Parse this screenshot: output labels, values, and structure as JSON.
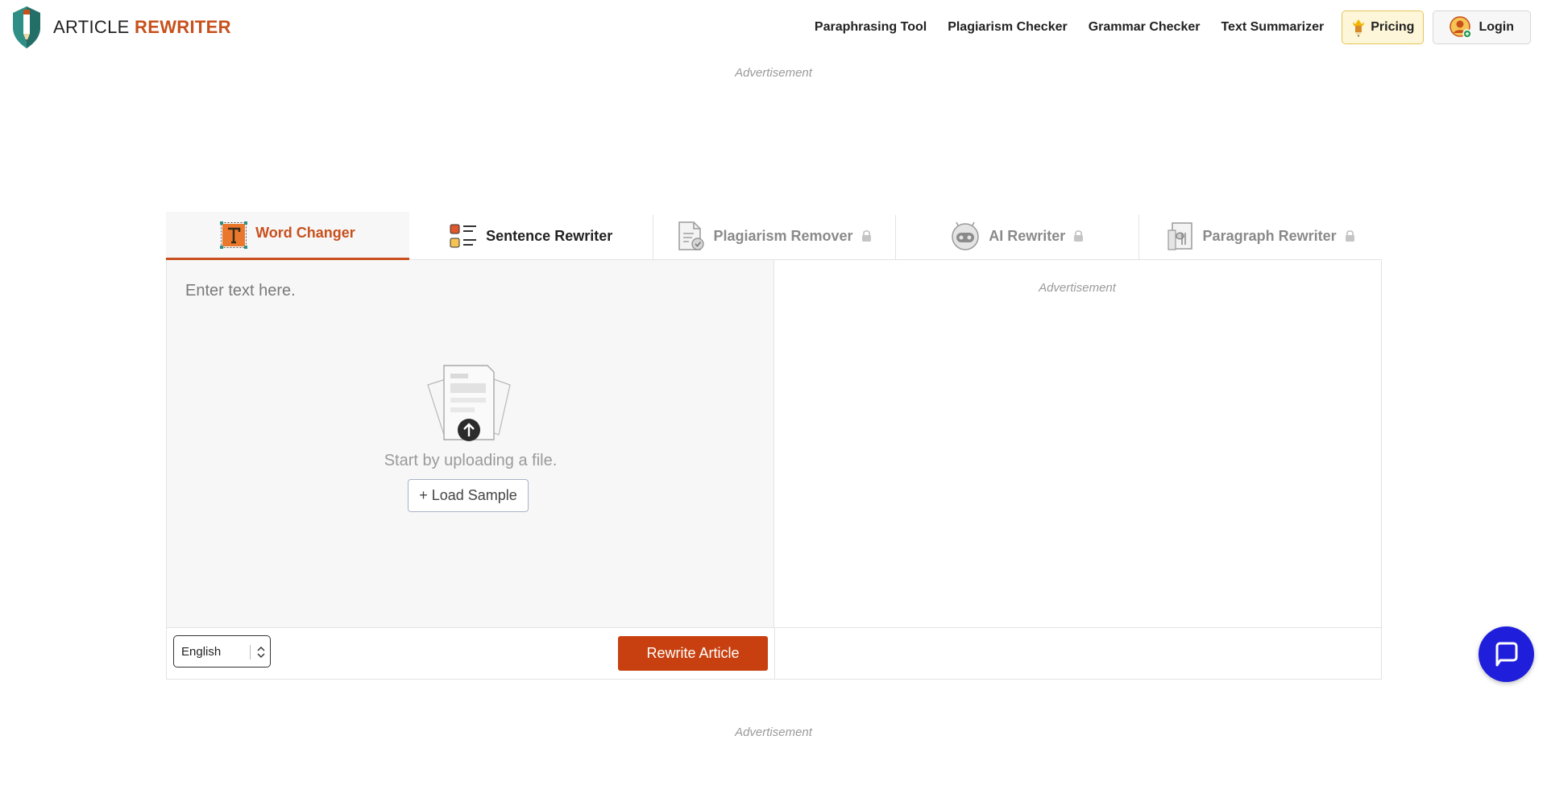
{
  "brand": {
    "name_plain": "ARTICLE",
    "name_accent": "REWRITER",
    "accent_color": "#c8501c"
  },
  "nav": {
    "links": [
      "Paraphrasing Tool",
      "Plagiarism Checker",
      "Grammar Checker",
      "Text Summarizer"
    ],
    "pricing_label": "Pricing",
    "login_label": "Login"
  },
  "ads": {
    "top": "Advertisement",
    "right_pane": "Advertisement",
    "bottom": "Advertisement"
  },
  "tabs": [
    {
      "label": "Word Changer",
      "state": "active",
      "icon": "text-t-icon"
    },
    {
      "label": "Sentence Rewriter",
      "state": "normal",
      "icon": "list-icon"
    },
    {
      "label": "Plagiarism Remover",
      "state": "locked",
      "icon": "document-check-icon"
    },
    {
      "label": "AI Rewriter",
      "state": "locked",
      "icon": "robot-icon"
    },
    {
      "label": "Paragraph Rewriter",
      "state": "locked",
      "icon": "paragraph-doc-icon"
    }
  ],
  "editor": {
    "placeholder": "Enter text here.",
    "upload_text": "Start by uploading a file.",
    "load_sample_label": "+ Load Sample"
  },
  "controls": {
    "language": "English",
    "rewrite_label": "Rewrite Article",
    "rewrite_color": "#c8400f"
  },
  "chat": {
    "icon": "chat-icon",
    "color": "#1f1fdb"
  }
}
